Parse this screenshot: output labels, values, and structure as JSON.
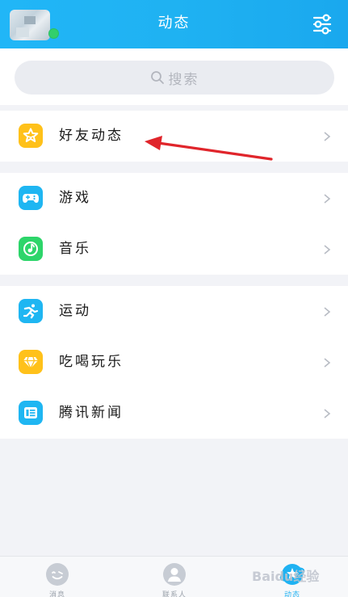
{
  "header": {
    "title": "动态",
    "avatar_icon": "avatar-icon",
    "filter_icon": "filter-sliders-icon",
    "accent_color": "#1fb2f2"
  },
  "search": {
    "placeholder": "搜索",
    "icon": "search-icon"
  },
  "groups": [
    {
      "items": [
        {
          "label": "好友动态",
          "icon": "star-icon",
          "icon_color": "#ffc11a"
        }
      ]
    },
    {
      "items": [
        {
          "label": "游戏",
          "icon": "gamepad-icon",
          "icon_color": "#1fb6f2"
        },
        {
          "label": "音乐",
          "icon": "music-icon",
          "icon_color": "#2dd56a"
        }
      ]
    },
    {
      "items": [
        {
          "label": "运动",
          "icon": "running-icon",
          "icon_color": "#1fb6f2"
        },
        {
          "label": "吃喝玩乐",
          "icon": "diamond-icon",
          "icon_color": "#ffc11a"
        },
        {
          "label": "腾讯新闻",
          "icon": "news-icon",
          "icon_color": "#1fb6f2"
        }
      ]
    }
  ],
  "annotation": {
    "type": "red-arrow-pointing-to-friends-feed",
    "color": "#e0252b"
  },
  "tabbar": {
    "tabs": [
      {
        "label": "消息",
        "icon": "message-icon",
        "active": false
      },
      {
        "label": "联系人",
        "icon": "contacts-icon",
        "active": false
      },
      {
        "label": "动态",
        "icon": "star-orbit-icon",
        "active": true
      }
    ]
  },
  "watermark": "Baidu经验"
}
